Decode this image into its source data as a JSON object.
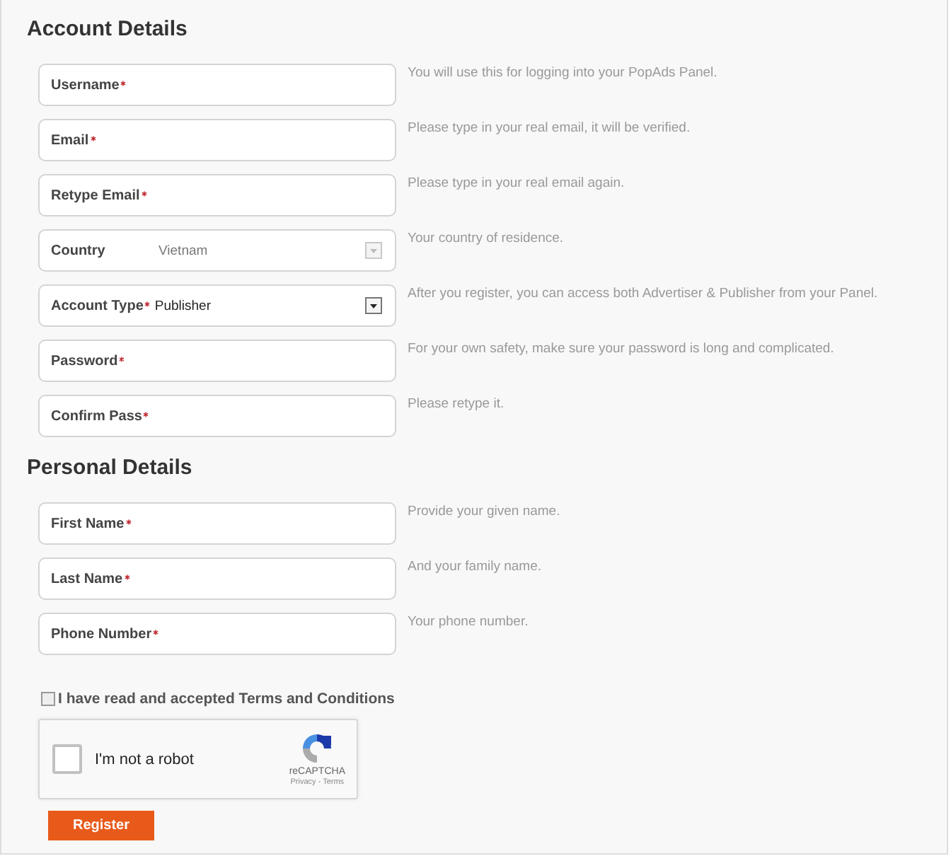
{
  "sections": [
    {
      "title": "Account Details",
      "fields": [
        {
          "kind": "text",
          "label": "Username",
          "required": true,
          "hint": "You will use this for logging into your PopAds Panel."
        },
        {
          "kind": "text",
          "label": "Email",
          "required": true,
          "hint": "Please type in your real email, it will be verified."
        },
        {
          "kind": "text",
          "label": "Retype Email",
          "required": true,
          "hint": "Please type in your real email again."
        },
        {
          "kind": "select",
          "label": "Country",
          "required": false,
          "value": "Vietnam",
          "disabled": true,
          "hint": "Your country of residence."
        },
        {
          "kind": "select",
          "label": "Account Type",
          "required": true,
          "value": "Publisher",
          "disabled": false,
          "hint": "After you register, you can access both Advertiser & Publisher from your Panel."
        },
        {
          "kind": "text",
          "label": "Password",
          "required": true,
          "hint": "For your own safety, make sure your password is long and complicated."
        },
        {
          "kind": "text",
          "label": "Confirm Pass",
          "required": true,
          "hint": "Please retype it."
        }
      ]
    },
    {
      "title": "Personal Details",
      "fields": [
        {
          "kind": "text",
          "label": "First Name",
          "required": true,
          "hint": "Provide your given name."
        },
        {
          "kind": "text",
          "label": "Last Name",
          "required": true,
          "hint": "And your family name."
        },
        {
          "kind": "text",
          "label": "Phone Number",
          "required": true,
          "hint": "Your phone number."
        }
      ]
    }
  ],
  "terms": {
    "label": "I have read and accepted Terms and Conditions",
    "checked": false
  },
  "captcha": {
    "label": "I'm not a robot",
    "checked": false,
    "brand": "reCAPTCHA",
    "links": "Privacy - Terms"
  },
  "submit": "Register"
}
